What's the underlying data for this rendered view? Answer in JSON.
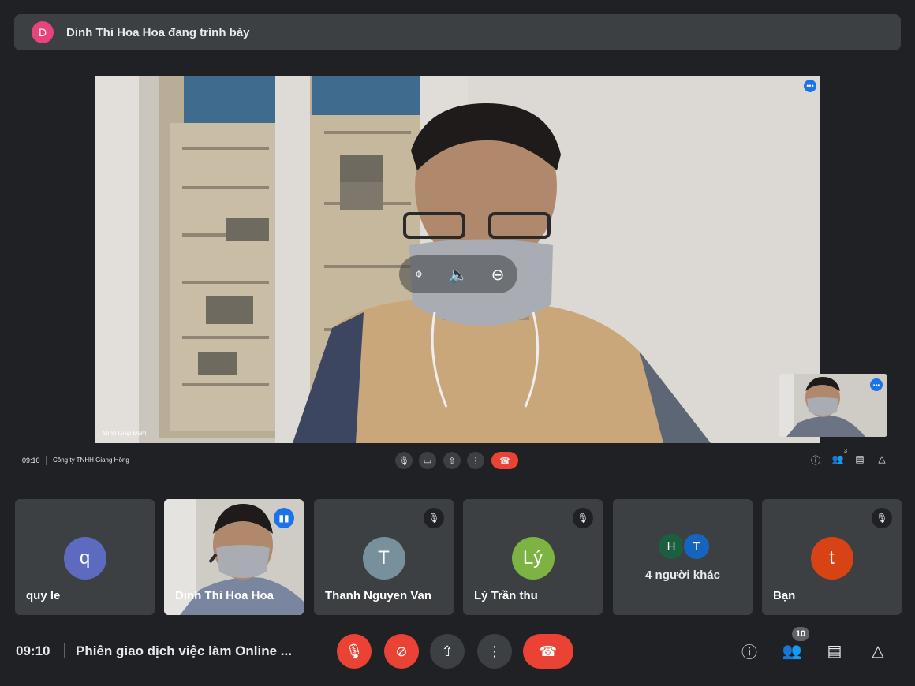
{
  "presenter_banner": {
    "avatar_letter": "D",
    "avatar_color": "#e8437b",
    "text": "Dinh Thi Hoa Hoa đang trình bày"
  },
  "stage": {
    "participant_name": "Minh Giáp Đàm",
    "more_icon": "more-dots-icon",
    "overlay_controls": [
      "pin-off-icon",
      "volume-icon",
      "minimize-icon"
    ]
  },
  "mini_bar": {
    "time": "09:10",
    "meeting_title": "Công ty TNHH Giang Hồng",
    "participant_count": "3"
  },
  "tiles": [
    {
      "name": "quy le",
      "avatar_letter": "q",
      "avatar_color": "#5c6bc0",
      "muted": false
    },
    {
      "name": "Dinh Thi Hoa Hoa",
      "type": "video",
      "speaking": true
    },
    {
      "name": "Thanh Nguyen Van",
      "avatar_letter": "T",
      "avatar_color": "#78909c",
      "muted": true
    },
    {
      "name": "Lý Trần thu",
      "avatar_letter": "Lý",
      "avatar_color": "#7cb342",
      "muted": true
    },
    {
      "name": "4 người khác",
      "type": "group",
      "avatars": [
        {
          "letter": "H",
          "color": "#1b5e40"
        },
        {
          "letter": "T",
          "color": "#1565c0"
        }
      ]
    },
    {
      "name": "Bạn",
      "avatar_letter": "t",
      "avatar_color": "#d84315",
      "muted": true
    }
  ],
  "bottom_bar": {
    "time": "09:10",
    "meeting_title": "Phiên giao dịch việc làm Online ...",
    "participant_count": "10"
  },
  "colors": {
    "background": "#202124",
    "surface": "#3c4043",
    "danger": "#ea4335",
    "accent": "#1a73e8"
  }
}
